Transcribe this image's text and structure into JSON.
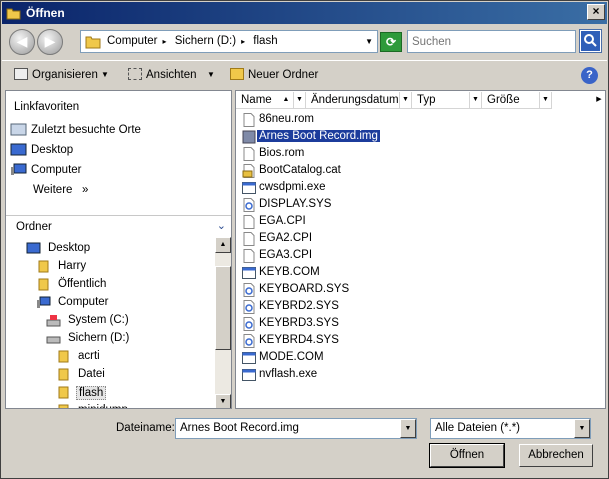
{
  "window": {
    "title": "Öffnen",
    "close_glyph": "×"
  },
  "address": {
    "crumbs": [
      "Computer",
      "Sichern (D:)",
      "flash"
    ],
    "separator": "▸"
  },
  "search": {
    "placeholder": "Suchen"
  },
  "toolbar": {
    "organize": "Organisieren",
    "views": "Ansichten",
    "new_folder": "Neuer Ordner",
    "help": "?"
  },
  "favorites": {
    "title": "Linkfavoriten",
    "items": [
      "Zuletzt besuchte Orte",
      "Desktop",
      "Computer",
      "Weitere"
    ],
    "more_glyph": "»"
  },
  "folders": {
    "title": "Ordner",
    "tree": [
      "Desktop",
      "Harry",
      "Öffentlich",
      "Computer",
      "System (C:)",
      "Sichern (D:)",
      "acrti",
      "Datei",
      "flash",
      "minidump"
    ]
  },
  "columns": [
    "Name",
    "Änderungsdatum",
    "Typ",
    "Größe"
  ],
  "files": [
    {
      "name": "86neu.rom",
      "icon": "blank-file-icon"
    },
    {
      "name": "Arnes Boot Record.img",
      "icon": "image-file-icon"
    },
    {
      "name": "Bios.rom",
      "icon": "blank-file-icon"
    },
    {
      "name": "BootCatalog.cat",
      "icon": "catalog-file-icon"
    },
    {
      "name": "cwsdpmi.exe",
      "icon": "exe-icon"
    },
    {
      "name": "DISPLAY.SYS",
      "icon": "system-file-icon"
    },
    {
      "name": "EGA.CPI",
      "icon": "blank-file-icon"
    },
    {
      "name": "EGA2.CPI",
      "icon": "blank-file-icon"
    },
    {
      "name": "EGA3.CPI",
      "icon": "blank-file-icon"
    },
    {
      "name": "KEYB.COM",
      "icon": "exe-icon"
    },
    {
      "name": "KEYBOARD.SYS",
      "icon": "system-file-icon"
    },
    {
      "name": "KEYBRD2.SYS",
      "icon": "system-file-icon"
    },
    {
      "name": "KEYBRD3.SYS",
      "icon": "system-file-icon"
    },
    {
      "name": "KEYBRD4.SYS",
      "icon": "system-file-icon"
    },
    {
      "name": "MODE.COM",
      "icon": "exe-icon"
    },
    {
      "name": "nvflash.exe",
      "icon": "exe-icon"
    }
  ],
  "selected_file": "Arnes Boot Record.img",
  "bottom": {
    "filename_label": "Dateiname:",
    "filename_value": "Arnes Boot Record.img",
    "filter_value": "Alle Dateien (*.*)",
    "open_label": "Öffnen",
    "cancel_label": "Abbrechen"
  },
  "colors": {
    "title_bar": "#0a246a",
    "selection": "#1c3c9c",
    "dialog_bg": "#d4d0c8"
  }
}
